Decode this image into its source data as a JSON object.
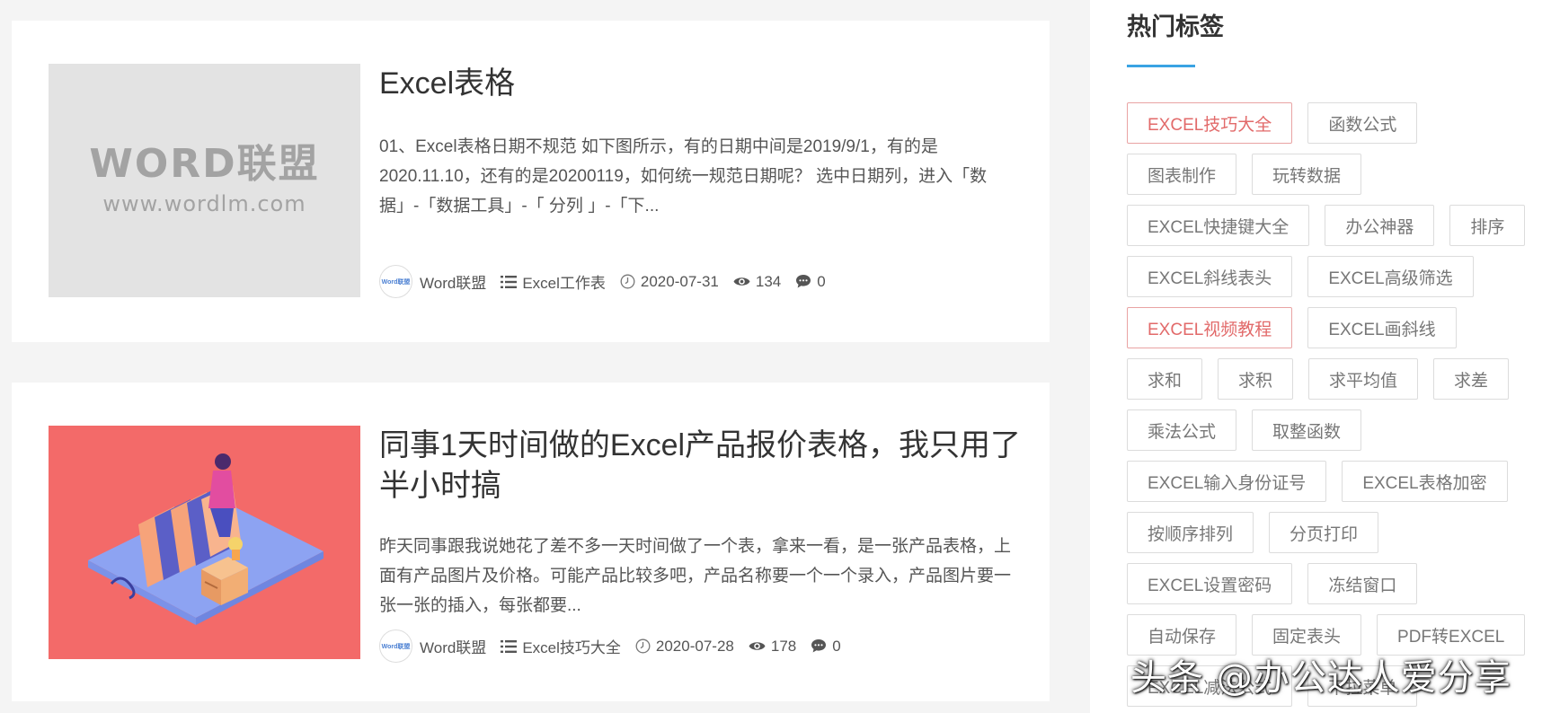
{
  "colors": {
    "accent": "#3aa3e3",
    "hot_tag": "#e26a6a",
    "thumb2_bg": "#f36a69"
  },
  "posts": [
    {
      "title": "Excel表格",
      "thumb_logo": "WORD联盟",
      "thumb_url": "www.wordlm.com",
      "excerpt": "01、Excel表格日期不规范 如下图所示，有的日期中间是2019/9/1，有的是2020.11.10，还有的是20200119，如何统一规范日期呢？ 选中日期列，进入「数据」-「数据工具」-「 分列 」-「下...",
      "meta": {
        "avatar_text": "Word联盟",
        "author": "Word联盟",
        "category": "Excel工作表",
        "date": "2020-07-31",
        "views": "134",
        "comments": "0"
      }
    },
    {
      "title": "同事1天时间做的Excel产品报价表格，我只用了半小时搞",
      "excerpt": "昨天同事跟我说她花了差不多一天时间做了一个表，拿来一看，是一张产品表格，上面有产品图片及价格。可能产品比较多吧，产品名称要一个一个录入，产品图片要一张一张的插入，每张都要...",
      "meta": {
        "avatar_text": "Word联盟",
        "author": "Word联盟",
        "category": "Excel技巧大全",
        "date": "2020-07-28",
        "views": "178",
        "comments": "0"
      }
    }
  ],
  "sidebar": {
    "title": "热门标签",
    "tag_rows": [
      [
        {
          "label": "EXCEL技巧大全",
          "hot": true
        },
        {
          "label": "函数公式",
          "hot": false
        }
      ],
      [
        {
          "label": "图表制作",
          "hot": false
        },
        {
          "label": "玩转数据",
          "hot": false
        }
      ],
      [
        {
          "label": "EXCEL快捷键大全",
          "hot": false
        },
        {
          "label": "办公神器",
          "hot": false
        },
        {
          "label": "排序",
          "hot": false
        }
      ],
      [
        {
          "label": "EXCEL斜线表头",
          "hot": false
        },
        {
          "label": "EXCEL高级筛选",
          "hot": false
        }
      ],
      [
        {
          "label": "EXCEL视频教程",
          "hot": true
        },
        {
          "label": "EXCEL画斜线",
          "hot": false
        }
      ],
      [
        {
          "label": "求和",
          "hot": false
        },
        {
          "label": "求积",
          "hot": false
        },
        {
          "label": "求平均值",
          "hot": false
        },
        {
          "label": "求差",
          "hot": false
        }
      ],
      [
        {
          "label": "乘法公式",
          "hot": false
        },
        {
          "label": "取整函数",
          "hot": false
        }
      ],
      [
        {
          "label": "EXCEL输入身份证号",
          "hot": false
        },
        {
          "label": "EXCEL表格加密",
          "hot": false
        }
      ],
      [
        {
          "label": "按顺序排列",
          "hot": false
        },
        {
          "label": "分页打印",
          "hot": false
        }
      ],
      [
        {
          "label": "EXCEL设置密码",
          "hot": false
        },
        {
          "label": "冻结窗口",
          "hot": false
        }
      ],
      [
        {
          "label": "自动保存",
          "hot": false
        },
        {
          "label": "固定表头",
          "hot": false
        },
        {
          "label": "PDF转EXCEL",
          "hot": false
        }
      ],
      [
        {
          "label": "EXCEL减法公式",
          "hot": false
        },
        {
          "label": "下拉菜单",
          "hot": false
        }
      ]
    ]
  },
  "watermark": "头条 @办公达人爱分享"
}
